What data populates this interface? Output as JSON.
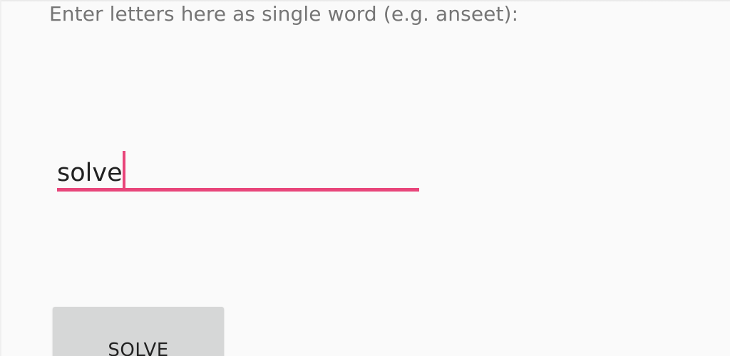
{
  "instruction": {
    "text": "Enter letters here as single word (e.g. anseet):"
  },
  "input": {
    "value": "solve",
    "accent_color": "#e8457a"
  },
  "button": {
    "label": "SOLVE"
  }
}
